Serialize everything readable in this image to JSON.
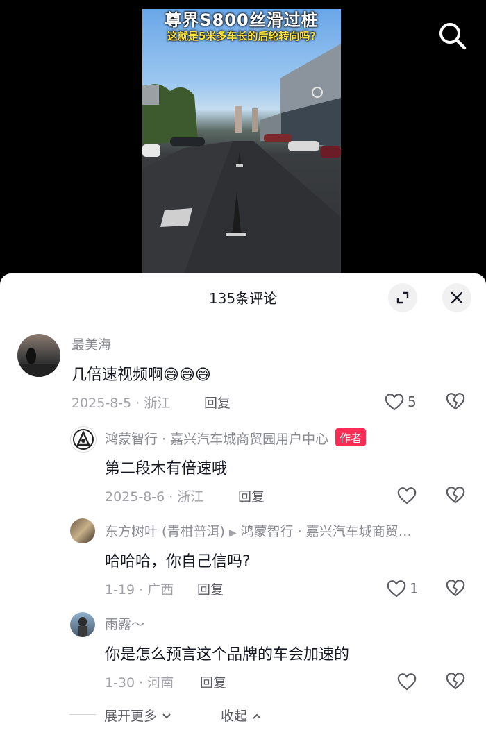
{
  "video": {
    "title_line1": "尊界S800丝滑过桩",
    "title_line2": "这就是5米多车长的后轮转向吗?",
    "search_icon": "search-icon"
  },
  "sheet": {
    "title": "135条评论",
    "expand_icon": "expand-icon",
    "close_icon": "close-icon"
  },
  "comments": [
    {
      "name": "最美海",
      "text": "几倍速视频啊",
      "emojis": [
        "😅",
        "😅",
        "😅"
      ],
      "date": "2025-8-5",
      "location": "浙江",
      "reply_label": "回复",
      "likes": "5"
    },
    {
      "name": "鸿蒙智行 · 嘉兴汽车城商贸园用户中心",
      "badge": "作者",
      "text": "第二段木有倍速哦",
      "date": "2025-8-6",
      "location": "浙江",
      "reply_label": "回复"
    },
    {
      "name": "东方树叶 (青柑普洱)",
      "reply_to": "鸿蒙智行 · 嘉兴汽车城商贸…",
      "text": "哈哈哈，你自己信吗?",
      "date": "1-19",
      "location": "广西",
      "reply_label": "回复",
      "likes": "1"
    },
    {
      "name": "雨露～",
      "text": "你是怎么预言这个品牌的车会加速的",
      "date": "1-30",
      "location": "河南",
      "reply_label": "回复"
    }
  ],
  "footer": {
    "expand_more": "展开更多",
    "collapse": "收起"
  },
  "colors": {
    "author_badge": "#fe2c55",
    "muted_text": "#8a8b91",
    "primary_text": "#161823"
  }
}
